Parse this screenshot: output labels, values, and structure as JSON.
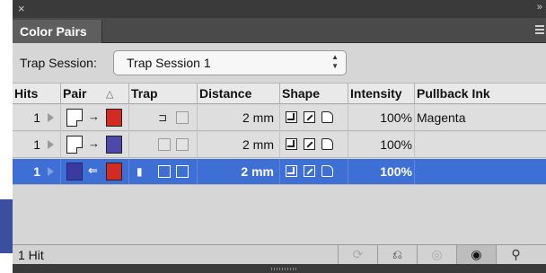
{
  "panel": {
    "close_glyph": "×",
    "collapse_glyph": "»",
    "tab_label": "Color Pairs",
    "menu_icon": "panel-menu-icon"
  },
  "session": {
    "label": "Trap Session:",
    "value": "Trap Session 1"
  },
  "columns": [
    "Hits",
    "Pair",
    "Trap",
    "Distance",
    "Shape",
    "Intensity",
    "Pullback Ink"
  ],
  "rows": [
    {
      "hits": "1",
      "pair_from": "paper",
      "pair_direction": "→",
      "pair_to": "red",
      "distance": "2 mm",
      "intensity": "100%",
      "pullback_ink": "Magenta",
      "selected": false
    },
    {
      "hits": "1",
      "pair_from": "paper",
      "pair_direction": "→",
      "pair_to": "blue",
      "distance": "2 mm",
      "intensity": "100%",
      "pullback_ink": "",
      "selected": false
    },
    {
      "hits": "1",
      "pair_from": "blue",
      "pair_direction": "⇐",
      "pair_to": "red",
      "distance": "2 mm",
      "intensity": "100%",
      "pullback_ink": "",
      "selected": true
    }
  ],
  "status": {
    "count": "1 Hit",
    "buttons": [
      "refresh-icon",
      "link-icon",
      "hide-eye-icon",
      "show-eye-icon",
      "magnifier-icon"
    ]
  },
  "colors": {
    "selection": "#3e6fd4",
    "red_swatch": "#d42a24",
    "blue_swatch": "#4c4aa8"
  }
}
